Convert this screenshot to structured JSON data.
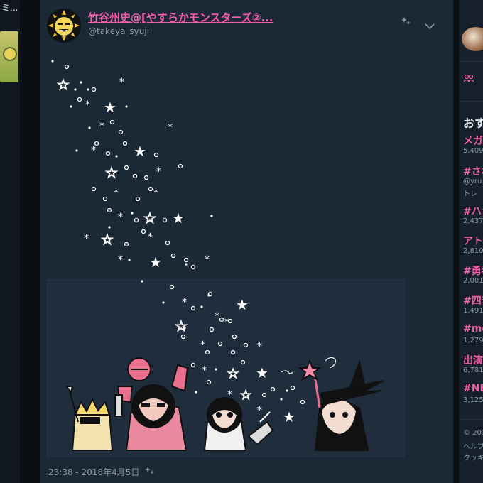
{
  "left": {
    "label": "ミ..."
  },
  "tweet": {
    "display_name": "竹谷州史@[やすらかモンスターズ②...",
    "handle": "@takeya_syuji",
    "timestamp": "23:38 - 2018年4月5日"
  },
  "icons": {
    "header_action": "sparkle-icon",
    "menu": "chevron-down-icon",
    "timestamp_action": "sparkle-icon",
    "people": "people-icon"
  },
  "sidebar": {
    "title": "おす",
    "trends": [
      {
        "tag": "メガ",
        "count": "5,409"
      },
      {
        "tag": "#され",
        "count": "@yru"
      },
      {
        "tag": "#ハラ",
        "count": "2,437"
      },
      {
        "tag": "アト",
        "count": "2,810"
      },
      {
        "tag": "#勇者",
        "count": "2,001"
      },
      {
        "tag": "#四千",
        "count": "1,491"
      },
      {
        "tag": "#me",
        "count": "1,279"
      },
      {
        "tag": "出演",
        "count": "6,781"
      },
      {
        "tag": "#NE",
        "count": "3,125"
      }
    ],
    "extra_line": "トレ",
    "footer": [
      "© 201",
      "ヘルプ",
      "クッキ"
    ]
  },
  "colors": {
    "accent_pink": "#f25ea7",
    "card_bg": "#1b2836",
    "page_bg": "#0b0f14",
    "muted": "#8899a6"
  }
}
